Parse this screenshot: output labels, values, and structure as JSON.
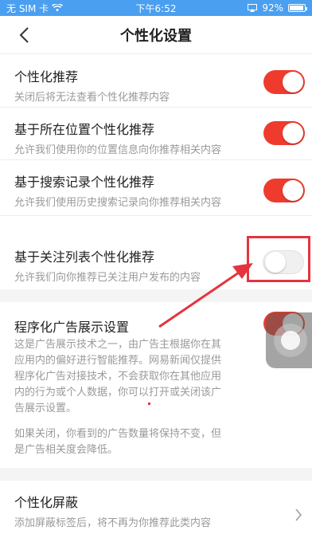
{
  "status_bar": {
    "carrier": "无 SIM 卡",
    "time": "下午6:52",
    "battery": "92%",
    "battery_level": 0.92
  },
  "nav": {
    "title": "个性化设置",
    "back_icon": "chevron-left-icon"
  },
  "items": [
    {
      "title": "个性化推荐",
      "desc": "关闭后将无法查看个性化推荐内容",
      "enabled": true
    },
    {
      "title": "基于所在位置个性化推荐",
      "desc": "允许我们使用你的位置信息向你推荐相关内容",
      "enabled": true
    },
    {
      "title": "基于搜索记录个性化推荐",
      "desc": "允许我们使用历史搜索记录向你推荐相关内容",
      "enabled": true
    },
    {
      "title": "基于关注列表个性化推荐",
      "desc": "允许我们向你推荐已关注用户发布的内容",
      "enabled": false
    }
  ],
  "ad_settings": {
    "title": "程序化广告展示设置",
    "enabled": true,
    "desc_lines": [
      "这是广告展示技术之一，由广告主根据你在其",
      "应用内的偏好进行智能推荐。网易新闻仅提供",
      "程序化广告对接技术，不会获取你在其他应用",
      "内的行为或个人数据，你可以打开或关闭该广",
      "告展示设置。"
    ],
    "note_lines": [
      "如果关闭，你看到的广告数量将保持不变，但",
      "是广告相关度会降低。"
    ]
  },
  "block": {
    "title": "个性化屏蔽",
    "desc": "添加屏蔽标签后，将不再为你推荐此类内容"
  },
  "colors": {
    "accent": "#ef3b2d",
    "status_bar": "#4a9ff0",
    "annotation": "#e5343f"
  }
}
